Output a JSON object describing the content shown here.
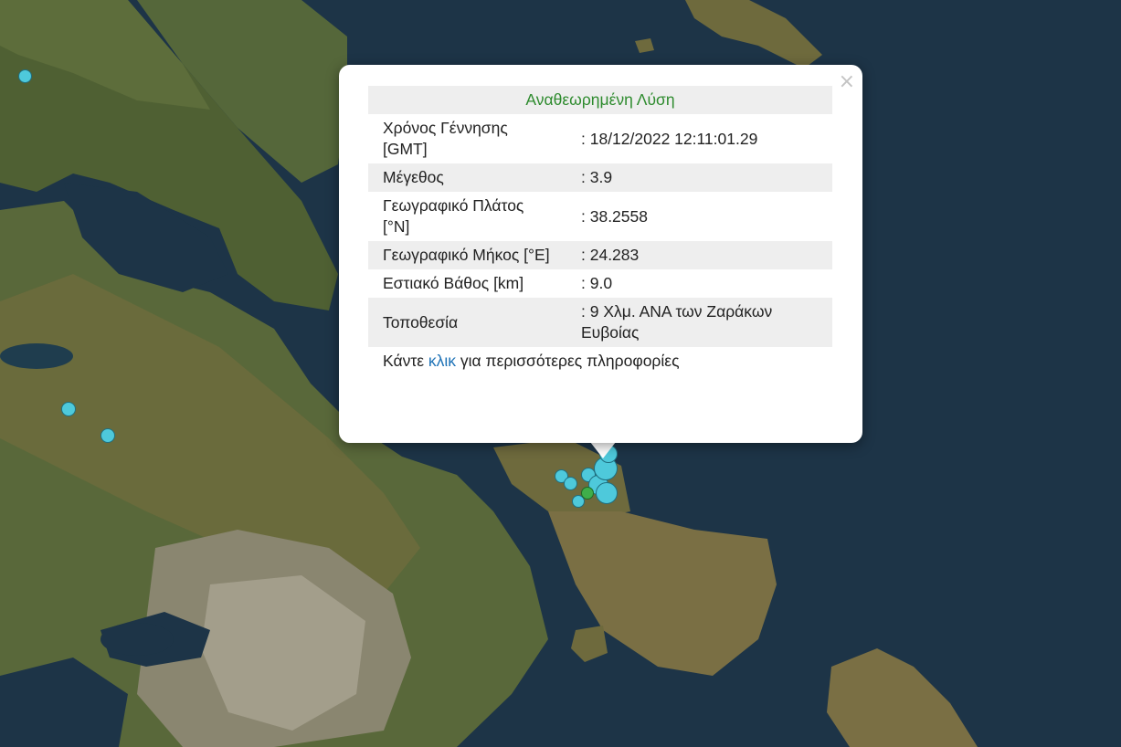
{
  "popup": {
    "close_symbol": "×",
    "heading": "Αναθεωρημένη Λύση",
    "rows": [
      {
        "label": "Χρόνος Γέννησης [GMT]",
        "value": ": 18/12/2022 12:11:01.29"
      },
      {
        "label": "Μέγεθος",
        "value": ": 3.9"
      },
      {
        "label": "Γεωγραφικό Πλάτος [°N]",
        "value": ": 38.2558"
      },
      {
        "label": "Γεωγραφικό Μήκος [°E]",
        "value": ": 24.283"
      },
      {
        "label": "Εστιακό Βάθος [km]",
        "value": ": 9.0"
      },
      {
        "label": "Τοποθεσία",
        "value": ": 9 Χλμ. ΑΝΑ των Ζαράκων Ευβοίας"
      }
    ],
    "more_prefix": "Κάντε ",
    "more_link": "κλικ",
    "more_suffix": " για περισσότερες πληροφορίες"
  },
  "colors": {
    "sea": "#1d3447",
    "land": "#5b6b3a",
    "quake_marker": "#4ec9db",
    "latest_marker": "#3fae4a",
    "heading_text": "#2e8b2e",
    "link": "#1f73b7"
  }
}
